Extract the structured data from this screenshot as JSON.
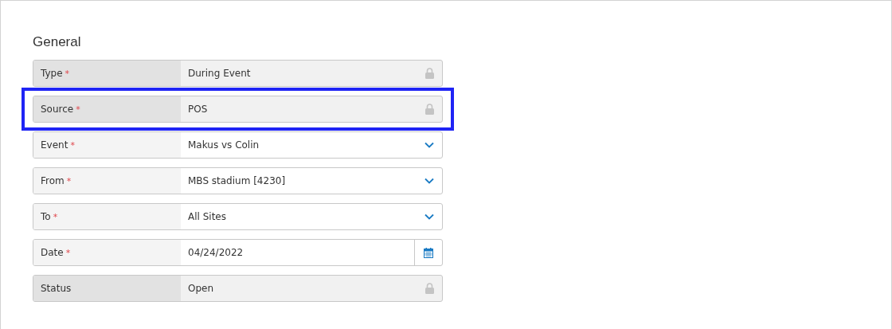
{
  "section_title": "General",
  "fields": [
    {
      "label": "Type",
      "required_mark": "*",
      "kind": "locked",
      "value": "During Event",
      "highlighted": false
    },
    {
      "label": "Source",
      "required_mark": "*",
      "kind": "locked",
      "value": "POS",
      "highlighted": true
    },
    {
      "label": "Event",
      "required_mark": "*",
      "kind": "select",
      "value": "Makus vs Colin",
      "highlighted": false
    },
    {
      "label": "From",
      "required_mark": "*",
      "kind": "select",
      "value": "MBS stadium [4230]",
      "highlighted": false
    },
    {
      "label": "To",
      "required_mark": "*",
      "kind": "select",
      "value": "All Sites",
      "highlighted": false
    },
    {
      "label": "Date",
      "required_mark": "*",
      "kind": "date",
      "value": "04/24/2022",
      "highlighted": false
    },
    {
      "label": "Status",
      "kind": "locked",
      "value": "Open",
      "highlighted": false
    }
  ]
}
